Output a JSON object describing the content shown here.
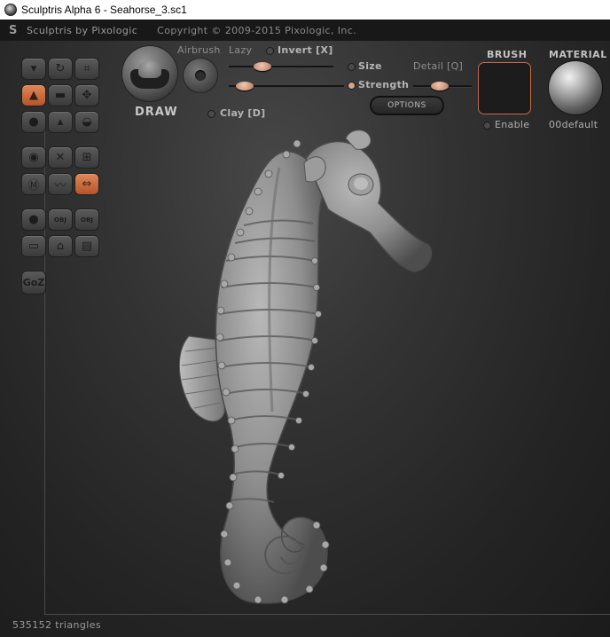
{
  "window": {
    "title": "Sculptris Alpha 6 - Seahorse_3.sc1"
  },
  "header": {
    "brand": "Sculptris by Pixologic",
    "copyright": "Copyright © 2009-2015 Pixologic, Inc."
  },
  "tools": [
    {
      "name": "crease-tool",
      "icon": "crease-icon",
      "active": false
    },
    {
      "name": "rotate-tool",
      "icon": "rotate-icon",
      "active": false
    },
    {
      "name": "scale-tool",
      "icon": "scale-icon",
      "active": false
    },
    {
      "name": "draw-tool",
      "icon": "draw-icon",
      "active": true
    },
    {
      "name": "flatten-tool",
      "icon": "flatten-icon",
      "active": false
    },
    {
      "name": "grab-tool",
      "icon": "move-icon",
      "active": false
    },
    {
      "name": "smooth-tool",
      "icon": "smooth-icon",
      "active": false
    },
    {
      "name": "inflate-tool",
      "icon": "inflate-icon",
      "active": false
    },
    {
      "name": "pinch-tool",
      "icon": "pinch-icon",
      "active": false
    },
    {
      "name": "reduce-tool",
      "icon": "reduce-icon",
      "active": false
    },
    {
      "name": "mask-tool",
      "icon": "mask-icon",
      "active": false
    },
    {
      "name": "grid-tool",
      "icon": "grid-icon",
      "active": false
    },
    {
      "name": "material-tool",
      "icon": "material-icon",
      "active": false
    },
    {
      "name": "wave-tool",
      "icon": "wave-icon",
      "active": false
    },
    {
      "name": "symmetry-tool",
      "icon": "symmetry-icon",
      "active": true
    },
    {
      "name": "sphere-button",
      "icon": "sphere-icon",
      "active": false
    },
    {
      "name": "import-obj-button",
      "icon": "import-obj-icon",
      "label": "OBJ",
      "active": false
    },
    {
      "name": "export-obj-button",
      "icon": "export-obj-icon",
      "label": "OBJ",
      "active": false
    },
    {
      "name": "plane-button",
      "icon": "plane-icon",
      "active": false
    },
    {
      "name": "open-button",
      "icon": "open-icon",
      "active": false
    },
    {
      "name": "save-button",
      "icon": "save-icon",
      "active": false
    }
  ],
  "goz": {
    "label": "GoZ"
  },
  "brush_settings": {
    "mode_label": "DRAW",
    "airbrush_label": "Airbrush",
    "lazy_label": "Lazy",
    "invert_label": "Invert [X]",
    "size_label": "Size",
    "strength_label": "Strength",
    "detail_label": "Detail [Q]",
    "clay_label": "Clay [D]",
    "options_label": "OPTIONS",
    "lazy_value": 0.35,
    "size_value": 0.2,
    "strength_value": 0.1,
    "detail_value": 0.3
  },
  "brush_panel": {
    "title": "BRUSH",
    "enable_label": "Enable"
  },
  "material_panel": {
    "title": "MATERIAL",
    "name": "00default"
  },
  "status": {
    "triangles": "535152 triangles"
  },
  "colors": {
    "accent": "#cf6a3a",
    "background": "#2a2a2a",
    "text": "#a0a0a0"
  }
}
